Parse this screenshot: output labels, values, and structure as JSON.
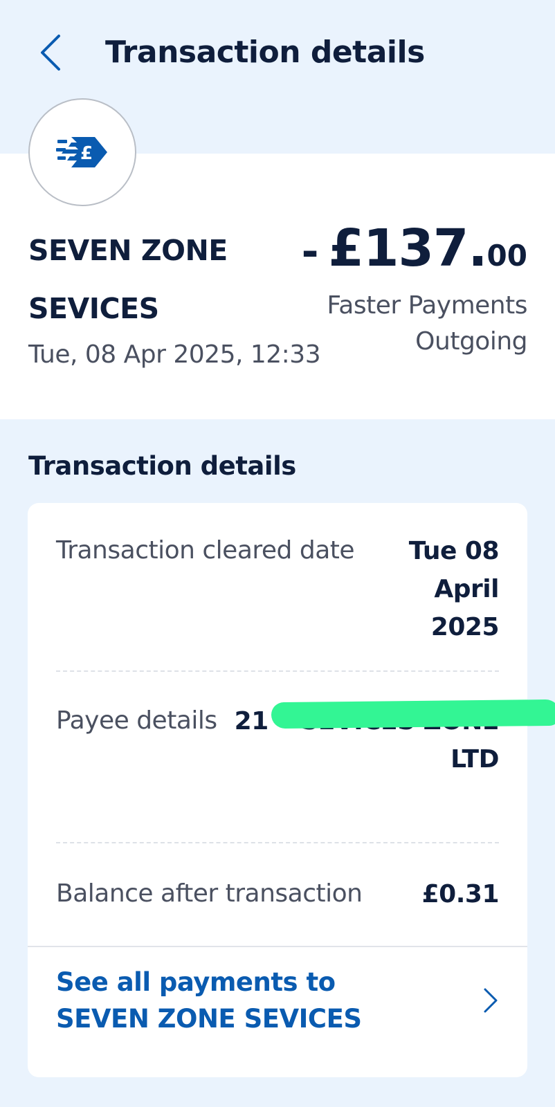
{
  "header": {
    "title": "Transaction details",
    "back_icon": "chevron-left-icon"
  },
  "merchant": {
    "logo_icon": "faster-payment-pound-icon",
    "name": "SEVEN ZONE SEVICES",
    "datetime": "Tue, 08 Apr 2025, 12:33"
  },
  "amount": {
    "sign": "-",
    "major": "£137.",
    "minor": "00",
    "type": "Faster Payments Outgoing"
  },
  "details": {
    "heading": "Transaction details",
    "rows": [
      {
        "label": "Transaction cleared date",
        "value": "Tue 08 April 2025"
      },
      {
        "label": "Payee details",
        "value": "21 • SEVICES ZONE LTD"
      },
      {
        "label": "Balance after transaction",
        "value": "£0.31"
      }
    ],
    "see_all_label": "See all payments to SEVEN ZONE SEVICES",
    "see_all_icon": "chevron-right-icon"
  },
  "colors": {
    "background": "#eaf3fd",
    "text_primary": "#0f1e3c",
    "text_secondary": "#4a5060",
    "link": "#0a5bb0",
    "logo_blue": "#0a5bb0",
    "redaction": "#33f594"
  }
}
